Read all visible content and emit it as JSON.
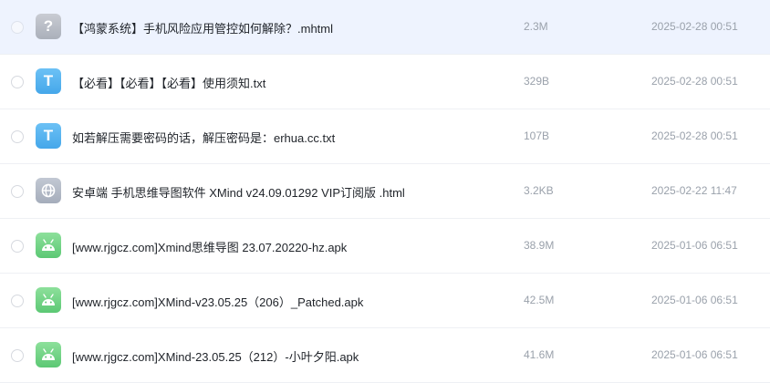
{
  "files": [
    {
      "name": "【鸿蒙系统】手机风险应用管控如何解除？.mhtml",
      "size": "2.3M",
      "date": "2025-02-28 00:51",
      "icon": "unknown-file-icon"
    },
    {
      "name": "【必看】【必看】【必看】使用须知.txt",
      "size": "329B",
      "date": "2025-02-28 00:51",
      "icon": "text-file-icon"
    },
    {
      "name": "如若解压需要密码的话，解压密码是：erhua.cc.txt",
      "size": "107B",
      "date": "2025-02-28 00:51",
      "icon": "text-file-icon"
    },
    {
      "name": "安卓端 手机思维导图软件 XMind v24.09.01292 VIP订阅版 .html",
      "size": "3.2KB",
      "date": "2025-02-22 11:47",
      "icon": "web-file-icon"
    },
    {
      "name": "[www.rjgcz.com]Xmind思维导图 23.07.20220-hz.apk",
      "size": "38.9M",
      "date": "2025-01-06 06:51",
      "icon": "android-apk-icon"
    },
    {
      "name": "[www.rjgcz.com]XMind-v23.05.25（206）_Patched.apk",
      "size": "42.5M",
      "date": "2025-01-06 06:51",
      "icon": "android-apk-icon"
    },
    {
      "name": "[www.rjgcz.com]XMind-23.05.25（212）-小叶夕阳.apk",
      "size": "41.6M",
      "date": "2025-01-06 06:51",
      "icon": "android-apk-icon"
    }
  ],
  "icon_glyphs": {
    "unknown": "?",
    "text": "T"
  },
  "colors": {
    "selected_row": "#eef3fe",
    "text_icon": "#4fb0ef",
    "apk_icon": "#6dd282",
    "meta_text": "#9aa1ab"
  }
}
